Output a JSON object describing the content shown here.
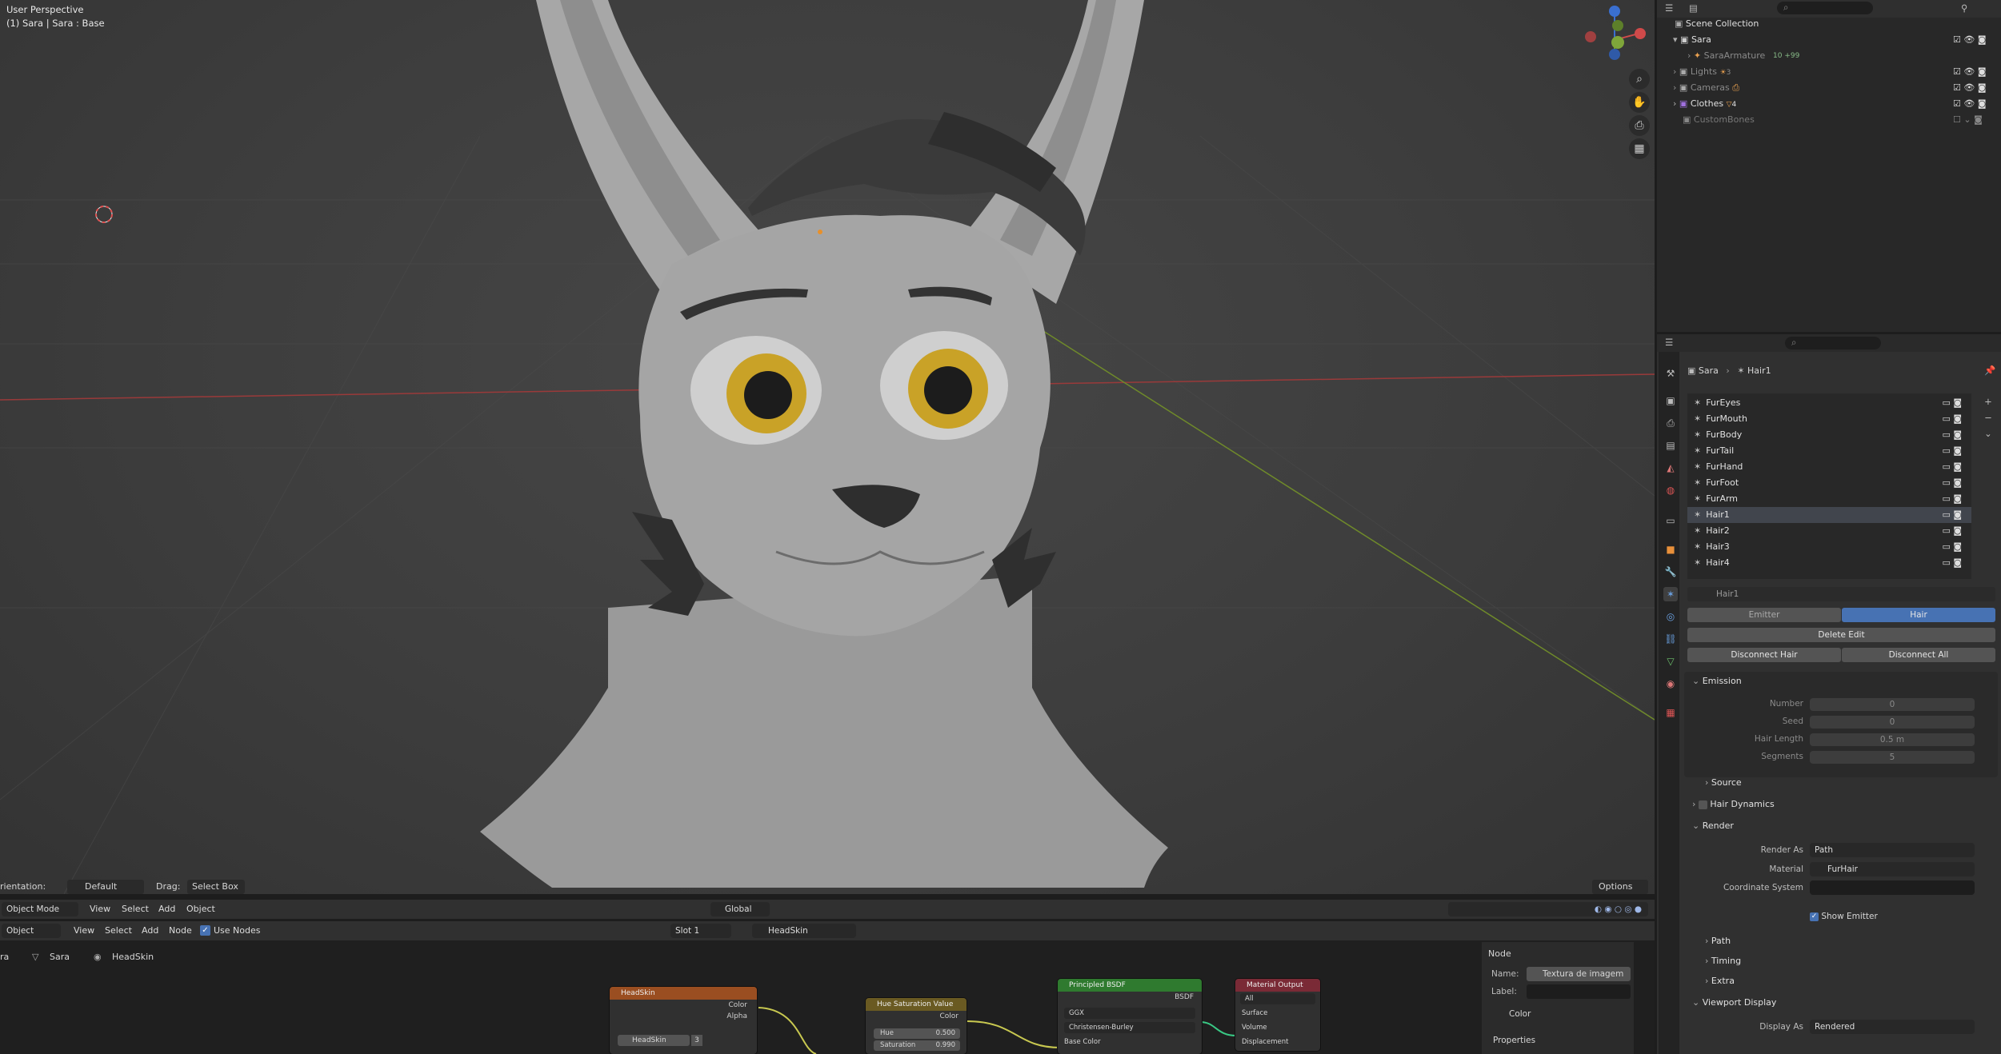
{
  "viewport": {
    "info_line1": "User Perspective",
    "info_line2": "(1) Sara | Sara : Base",
    "orientation_label": "rientation:",
    "orientation_value": "Default",
    "drag_label": "Drag:",
    "drag_value": "Select Box",
    "options": "Options",
    "mode": "Object Mode",
    "menus": [
      "View",
      "Select",
      "Add",
      "Object"
    ],
    "transform": "Global"
  },
  "outliner": {
    "root": "Scene Collection",
    "items": [
      {
        "label": "Sara",
        "count": ""
      },
      {
        "label": "SaraArmature",
        "count": "10 +99"
      },
      {
        "label": "Lights",
        "count": "3"
      },
      {
        "label": "Cameras",
        "count": ""
      },
      {
        "label": "Clothes",
        "count": "4"
      },
      {
        "label": "CustomBones",
        "count": ""
      }
    ]
  },
  "properties": {
    "breadcrumb_object": "Sara",
    "breadcrumb_item": "Hair1",
    "particle_systems": [
      "FurEyes",
      "FurMouth",
      "FurBody",
      "FurTail",
      "FurHand",
      "FurFoot",
      "FurArm",
      "Hair1",
      "Hair2",
      "Hair3",
      "Hair4"
    ],
    "selected_system": "Hair1",
    "settings_name": "Hair1",
    "type_emitter": "Emitter",
    "type_hair": "Hair",
    "delete_edit": "Delete Edit",
    "disconnect_hair": "Disconnect Hair",
    "disconnect_all": "Disconnect All",
    "emission": "Emission",
    "number_label": "Number",
    "number_value": "0",
    "seed_label": "Seed",
    "seed_value": "0",
    "hair_length_label": "Hair Length",
    "hair_length_value": "0.5 m",
    "segments_label": "Segments",
    "segments_value": "5",
    "source": "Source",
    "hair_dynamics": "Hair Dynamics",
    "render": "Render",
    "render_as_label": "Render As",
    "render_as_value": "Path",
    "material_label": "Material",
    "material_value": "FurHair",
    "coord_system_label": "Coordinate System",
    "show_emitter": "Show Emitter",
    "path": "Path",
    "timing": "Timing",
    "extra": "Extra",
    "viewport_display": "Viewport Display",
    "display_as_label": "Display As",
    "display_as_value": "Rendered"
  },
  "node_editor": {
    "object_dropdown": "Object",
    "menus": [
      "View",
      "Select",
      "Add",
      "Node"
    ],
    "use_nodes": "Use Nodes",
    "slot": "Slot 1",
    "material": "HeadSkin",
    "breadcrumb": [
      "ra",
      "Sara",
      "HeadSkin"
    ],
    "n_panel": {
      "node_header": "Node",
      "name_label": "Name:",
      "name_value": "Textura de imagem",
      "label_label": "Label:",
      "color": "Color",
      "properties": "Properties"
    },
    "nodes": {
      "image": {
        "title": "HeadSkin",
        "out_color": "Color",
        "out_alpha": "Alpha",
        "image_name": "HeadSkin",
        "users": "3"
      },
      "hsv": {
        "title": "Hue Saturation Value",
        "out_color": "Color",
        "hue_label": "Hue",
        "hue_value": "0.500",
        "sat_label": "Saturation",
        "sat_value": "0.990"
      },
      "bsdf": {
        "title": "Principled BSDF",
        "out_bsdf": "BSDF",
        "distribution": "GGX",
        "subsurface": "Christensen-Burley",
        "base_color": "Base Color"
      },
      "output": {
        "title": "Material Output",
        "target": "All",
        "surface": "Surface",
        "volume": "Volume",
        "displacement": "Displacement"
      }
    }
  }
}
